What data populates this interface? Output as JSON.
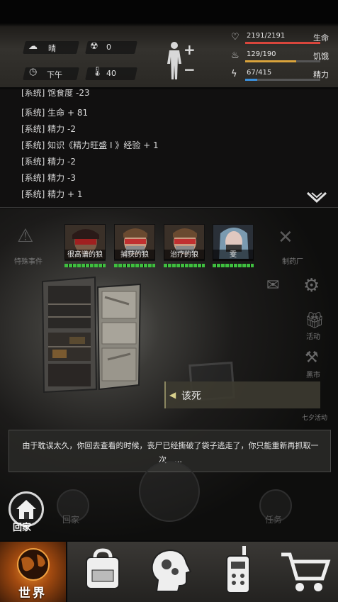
{
  "top": {
    "weather": "晴",
    "radiation": "0",
    "time_of_day": "下午",
    "temperature": "40"
  },
  "stats": [
    {
      "name": "生命",
      "value": "2191/2191",
      "icon": "heart-icon",
      "fraction": 1.0,
      "color": "#d9463c"
    },
    {
      "name": "饥饿",
      "value": "129/190",
      "icon": "stomach-icon",
      "fraction": 0.68,
      "color": "#d9a33c"
    },
    {
      "name": "精力",
      "value": "67/415",
      "icon": "energy-icon",
      "fraction": 0.16,
      "color": "#3c8fd9"
    }
  ],
  "log": [
    "[系统] 饱食度 -23",
    "[系统] 生命 + 81",
    "[系统] 精力 -2",
    "[系统] 知识《精力旺盛 I 》经验 + 1",
    "[系统] 精力 -2",
    "[系统] 精力 -3",
    "[系统] 精力 + 1"
  ],
  "survivors": [
    {
      "name": "很高谱的狼"
    },
    {
      "name": "捕获的狼"
    },
    {
      "name": "治疗的狼"
    },
    {
      "name": "雯"
    }
  ],
  "side_labels": {
    "special_event": "特殊事件",
    "pharmacy": "制药厂",
    "activity": "活动",
    "black_market": "黑市",
    "seven_day": "七夕活动"
  },
  "choice": {
    "label": "该死"
  },
  "message": "由于耽误太久，你回去查看的时候，丧尸已经撕破了袋子逃走了，你只能重新再抓取一次……",
  "home_button": {
    "label": "回家"
  },
  "faded": {
    "home2": "回家",
    "task": "任务"
  },
  "nav": {
    "world_label": "世界",
    "items": [
      "backpack-icon",
      "skills-head-icon",
      "radio-icon",
      "shop-cart-icon"
    ]
  }
}
